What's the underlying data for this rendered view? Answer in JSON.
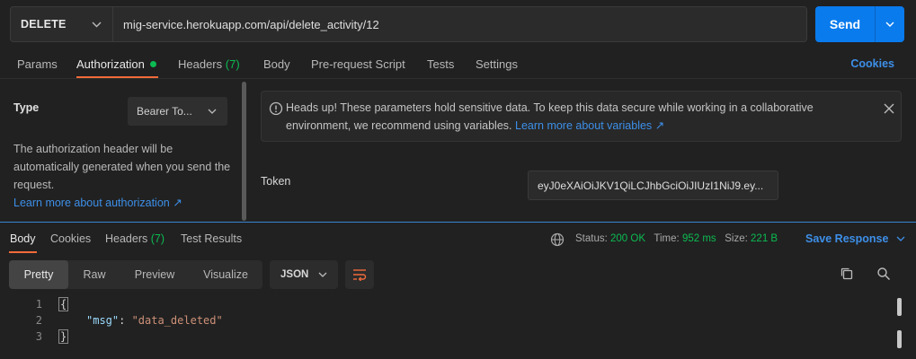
{
  "request": {
    "method": "DELETE",
    "url": "mig-service.herokuapp.com/api/delete_activity/12",
    "send_label": "Send"
  },
  "request_tabs": {
    "params": "Params",
    "authorization": "Authorization",
    "headers": "Headers",
    "headers_count": "(7)",
    "body": "Body",
    "pre_request": "Pre-request Script",
    "tests": "Tests",
    "settings": "Settings",
    "cookies": "Cookies"
  },
  "auth": {
    "type_label": "Type",
    "type_value": "Bearer To...",
    "description": "The authorization header will be automatically generated when you send the request.",
    "learn_more": "Learn more about authorization ↗",
    "notice_text": "Heads up! These parameters hold sensitive data. To keep this data secure while working in a collaborative environment, we recommend using variables.",
    "notice_link": "Learn more about variables ↗",
    "token_label": "Token",
    "token_value": "eyJ0eXAiOiJKV1QiLCJhbGciOiJIUzI1NiJ9.ey..."
  },
  "response_tabs": {
    "body": "Body",
    "cookies": "Cookies",
    "headers": "Headers",
    "headers_count": "(7)",
    "test_results": "Test Results"
  },
  "status": {
    "status_label": "Status:",
    "status_value": "200 OK",
    "time_label": "Time:",
    "time_value": "952 ms",
    "size_label": "Size:",
    "size_value": "221 B",
    "save_response": "Save Response"
  },
  "view": {
    "modes": [
      "Pretty",
      "Raw",
      "Preview",
      "Visualize"
    ],
    "active_mode": "Pretty",
    "format": "JSON"
  },
  "code": {
    "line_numbers": [
      "1",
      "2",
      "3"
    ],
    "open_brace": "{",
    "key": "\"msg\"",
    "colon": ": ",
    "value": "\"data_deleted\"",
    "close_brace": "}"
  },
  "colors": {
    "accent_blue": "#097bed",
    "link_blue": "#3d8fe8",
    "success_green": "#0cbb52",
    "tab_orange": "#f26b3a"
  }
}
